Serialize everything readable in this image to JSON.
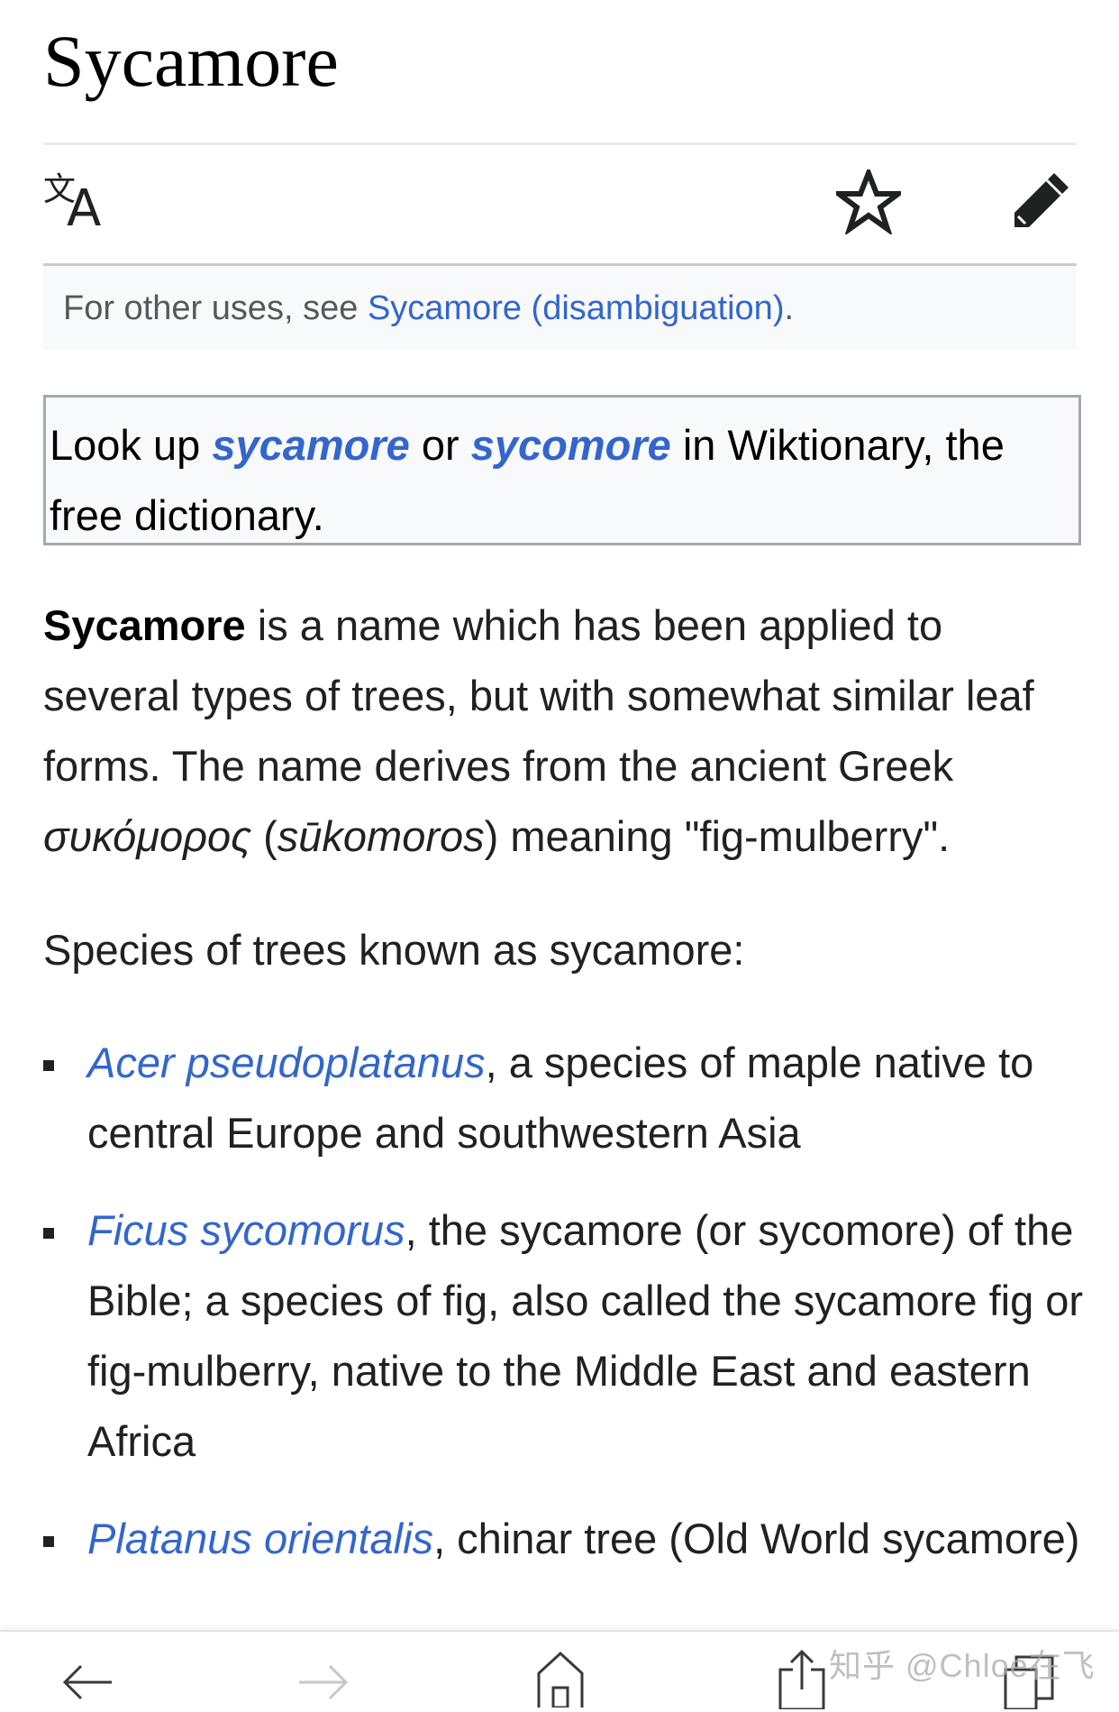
{
  "page": {
    "title": "Sycamore"
  },
  "toolbar": {
    "language_icon": "translate-icon",
    "watch_icon": "star-icon",
    "edit_icon": "pencil-icon"
  },
  "hatnote": {
    "prefix": "For other uses, see ",
    "link": "Sycamore (disambiguation)",
    "suffix": "."
  },
  "wiktionary": {
    "prefix": "Look up ",
    "term1": "sycamore",
    "middle": " or ",
    "term2": "sycomore",
    "suffix": " in Wiktionary, the free dictionary."
  },
  "intro": {
    "bold": "Sycamore",
    "text1": " is a name which has been applied to several types of trees, but with somewhat similar leaf forms. The name derives from the ancient Greek ",
    "greek": "συκόμορος",
    "text2": " (",
    "translit": "sūkomoros",
    "text3": ") meaning \"fig-mulberry\"."
  },
  "species_heading": "Species of trees known as sycamore:",
  "species": [
    {
      "name": "Acer pseudoplatanus",
      "description": ", a species of maple native to central Europe and southwestern Asia"
    },
    {
      "name": "Ficus sycomorus",
      "description": ", the sycamore (or sycomore) of the Bible; a species of fig, also called the sycamore fig or fig-mulberry, native to the Middle East and eastern Africa"
    },
    {
      "name": "Platanus orientalis",
      "description": ", chinar tree (Old World sycamore)"
    }
  ],
  "bottom_nav": {
    "back_icon": "arrow-left-icon",
    "forward_icon": "arrow-right-icon",
    "home_icon": "home-icon",
    "share_icon": "share-icon",
    "tabs_icon": "tabs-icon"
  },
  "watermark": "知乎 @Chloe在飞",
  "colors": {
    "link": "#3366cc",
    "text": "#202122",
    "hatnote_bg": "#f8f9fa",
    "border": "#a2a9b1"
  }
}
